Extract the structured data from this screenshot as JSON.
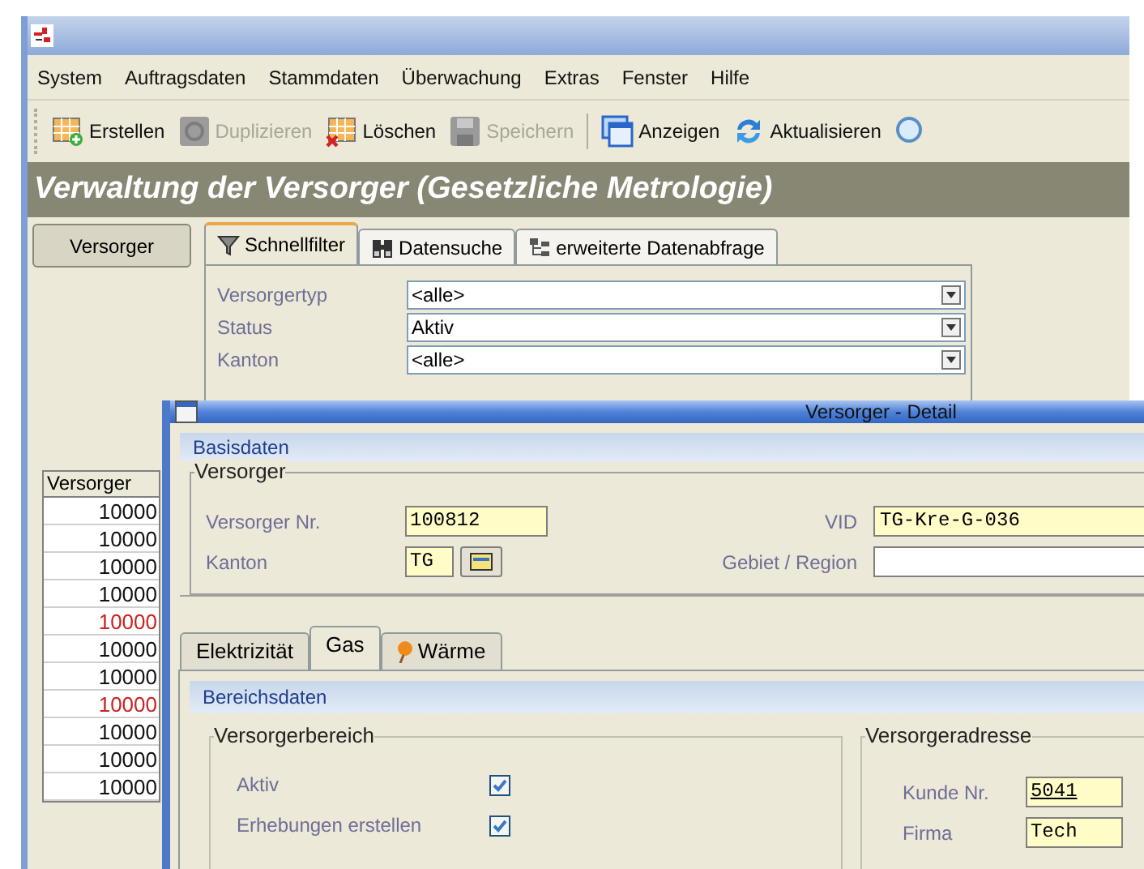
{
  "menu": [
    "System",
    "Auftragsdaten",
    "Stammdaten",
    "Überwachung",
    "Extras",
    "Fenster",
    "Hilfe"
  ],
  "toolbar": [
    {
      "kind": "create",
      "label": "Erstellen",
      "disabled": false
    },
    {
      "kind": "duplicate",
      "label": "Duplizieren",
      "disabled": true
    },
    {
      "kind": "delete",
      "label": "Löschen",
      "disabled": false
    },
    {
      "kind": "save",
      "label": "Speichern",
      "disabled": true
    },
    {
      "kind": "separator"
    },
    {
      "kind": "show",
      "label": "Anzeigen",
      "disabled": false
    },
    {
      "kind": "refresh",
      "label": "Aktualisieren",
      "disabled": false
    },
    {
      "kind": "search"
    }
  ],
  "heading": "Verwaltung der Versorger (Gesetzliche Metrologie)",
  "side_button": "Versorger",
  "filter_tabs": [
    {
      "kind": "filter",
      "label": "Schnellfilter",
      "selected": true
    },
    {
      "kind": "binoculars",
      "label": "Datensuche",
      "selected": false
    },
    {
      "kind": "tree",
      "label": "erweiterte Datenabfrage",
      "selected": false
    }
  ],
  "filters": [
    {
      "label": "Versorgertyp",
      "value": "<alle>"
    },
    {
      "label": "Status",
      "value": "Aktiv"
    },
    {
      "label": "Kanton",
      "value": "<alle>"
    }
  ],
  "table": {
    "columns": [
      "Versorger"
    ],
    "rows": [
      {
        "value": "10000",
        "flagged": false
      },
      {
        "value": "10000",
        "flagged": false
      },
      {
        "value": "10000",
        "flagged": false
      },
      {
        "value": "10000",
        "flagged": false
      },
      {
        "value": "10000",
        "flagged": true
      },
      {
        "value": "10000",
        "flagged": false
      },
      {
        "value": "10000",
        "flagged": false
      },
      {
        "value": "10000",
        "flagged": true
      },
      {
        "value": "10000",
        "flagged": false
      },
      {
        "value": "10000",
        "flagged": false
      },
      {
        "value": "10000",
        "flagged": false
      }
    ]
  },
  "detail_window": {
    "title": "Versorger - Detail",
    "section": "Basisdaten",
    "group": "Versorger",
    "left_fields": [
      {
        "label": "Versorger Nr.",
        "value": "100812",
        "kind": "text"
      },
      {
        "label": "Kanton",
        "value": "TG",
        "kind": "lookup"
      }
    ],
    "right_fields": [
      {
        "label": "VID",
        "value": "TG-Kre-G-036",
        "required": true
      },
      {
        "label": "Gebiet / Region",
        "required": false
      }
    ],
    "tabs": [
      {
        "label": "Elektrizität",
        "selected": false
      },
      {
        "label": "Gas",
        "selected": true
      },
      {
        "label": "Wärme",
        "selected": false
      }
    ],
    "area_section": "Bereichsdaten",
    "area_group": "Versorgerbereich",
    "area_checks": [
      {
        "label": "Aktiv",
        "checked": true
      },
      {
        "label": "Erhebungen erstellen",
        "checked": true
      }
    ],
    "address_group": "Versorgeradresse",
    "address_fields": [
      {
        "label": "Kunde Nr.",
        "value": "5041",
        "underlined": true
      },
      {
        "label": "Firma",
        "value": "Tech",
        "underlined": false
      }
    ]
  }
}
